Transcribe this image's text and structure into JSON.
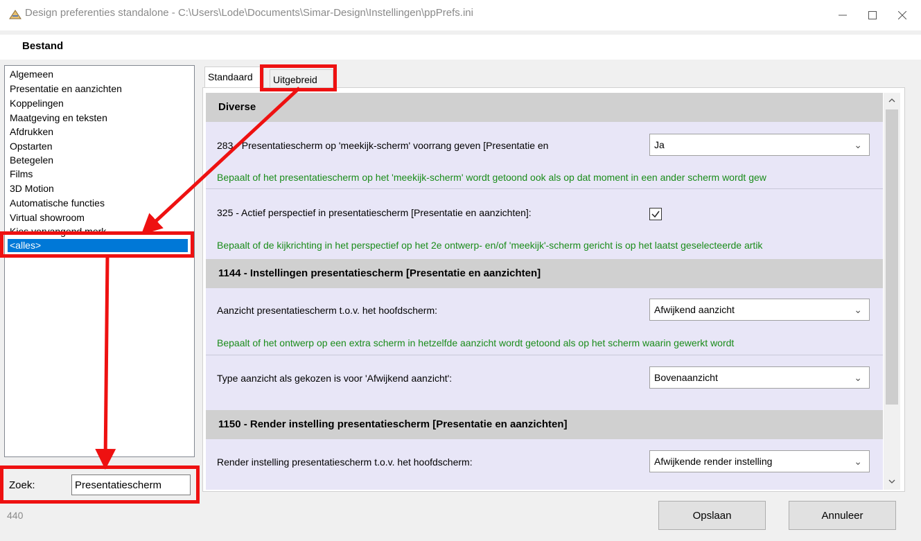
{
  "window": {
    "title": "Design preferenties standalone - C:\\Users\\Lode\\Documents\\Simar-Design\\Instellingen\\ppPrefs.ini",
    "minimize": "—",
    "maximize": "☐",
    "close": "✕"
  },
  "menu": {
    "bestand": "Bestand"
  },
  "sidebar": {
    "items": [
      "Algemeen",
      "Presentatie en aanzichten",
      "Koppelingen",
      "Maatgeving en teksten",
      "Afdrukken",
      "Opstarten",
      "Betegelen",
      "Films",
      "3D Motion",
      "Automatische functies",
      "Virtual showroom",
      "Kies vervangend merk",
      "<alles>"
    ],
    "selected": "<alles>"
  },
  "search": {
    "label": "Zoek:",
    "value": "Presentatiescherm"
  },
  "status": {
    "count": "440"
  },
  "tabs": {
    "standaard": "Standaard",
    "uitgebreid": "Uitgebreid"
  },
  "sections": {
    "diverse": {
      "title": "Diverse",
      "row1": {
        "label": "283 - Presentatiescherm op 'meekijk-scherm' voorrang geven [Presentatie en",
        "value": "Ja",
        "desc": "Bepaalt of het presentatiescherm op het 'meekijk-scherm' wordt getoond ook als op dat moment in een ander scherm wordt gew"
      },
      "row2": {
        "label": "325 - Actief perspectief in presentatiescherm [Presentatie en aanzichten]:",
        "checked": true,
        "desc": "Bepaalt of de kijkrichting in het perspectief op het 2e ontwerp- en/of 'meekijk'-scherm gericht is op het laatst geselecteerde artik"
      }
    },
    "s1144": {
      "title": "1144 - Instellingen presentatiescherm [Presentatie en aanzichten]",
      "row1": {
        "label": "Aanzicht presentatiescherm t.o.v. het hoofdscherm:",
        "value": "Afwijkend aanzicht",
        "desc": "Bepaalt of het ontwerp op een extra scherm in hetzelfde aanzicht wordt getoond als op het scherm waarin gewerkt wordt"
      },
      "row2": {
        "label": "Type aanzicht als gekozen is voor 'Afwijkend aanzicht':",
        "value": "Bovenaanzicht"
      }
    },
    "s1150": {
      "title": "1150 - Render instelling presentatiescherm [Presentatie en aanzichten]",
      "row1": {
        "label": "Render instelling presentatiescherm t.o.v. het hoofdscherm:",
        "value": "Afwijkende render instelling"
      }
    }
  },
  "buttons": {
    "save": "Opslaan",
    "cancel": "Annuleer"
  },
  "colors": {
    "accent": "#0078d7",
    "annotation": "#ee1111",
    "description": "#1a8c1a",
    "section_bg": "#d0d0d0",
    "content_bg": "#e8e6f7"
  }
}
